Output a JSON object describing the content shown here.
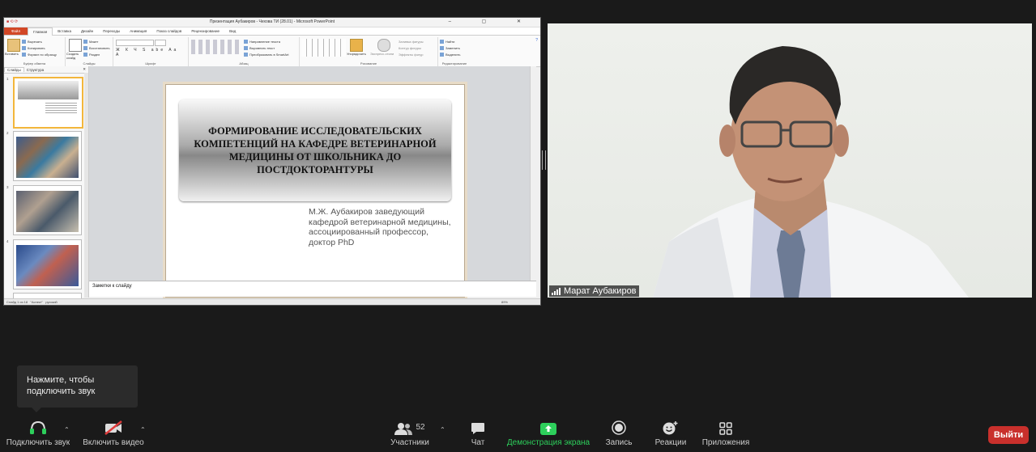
{
  "ppt": {
    "window_title": "Презентация Аубакиров - Чехова ТИ (28.01) - Microsoft PowerPoint",
    "tabs": [
      "Файл",
      "Главная",
      "Вставка",
      "Дизайн",
      "Переходы",
      "Анимация",
      "Показ слайдов",
      "Рецензирование",
      "Вид"
    ],
    "ribbon": {
      "clipboard": {
        "label": "Буфер обмена",
        "paste": "Вставить",
        "cut": "Вырезать",
        "copy": "Копировать",
        "format": "Формат по образцу"
      },
      "slides": {
        "label": "Слайды",
        "new_slide": "Создать слайд",
        "layout": "Макет",
        "reset": "Восстановить",
        "section": "Раздел"
      },
      "font": {
        "label": "Шрифт"
      },
      "paragraph": {
        "label": "Абзац",
        "direction": "Направление текста",
        "align": "Выровнять текст",
        "smartart": "Преобразовать в SmartArt"
      },
      "drawing": {
        "label": "Рисование",
        "arrange": "Упорядочить",
        "quick_styles": "Экспресс-стили",
        "fill": "Заливка фигуры",
        "outline": "Контур фигуры",
        "effects": "Эффекты фигур"
      },
      "editing": {
        "label": "Редактирование",
        "find": "Найти",
        "replace": "Заменить",
        "select": "Выделить"
      }
    },
    "panel_tabs": [
      "Слайды",
      "Структура"
    ],
    "thumb_numbers": [
      "1",
      "2",
      "3",
      "4"
    ],
    "slide": {
      "title": "ФОРМИРОВАНИЕ ИССЛЕДОВАТЕЛЬСКИХ КОМПЕТЕНЦИЙ НА КАФЕДРЕ ВЕТЕРИНАРНОЙ МЕДИЦИНЫ ОТ ШКОЛЬНИКА  ДО ПОСТДОКТОРАНТУРЫ",
      "subtitle": "М.Ж. Аубакиров заведующий кафедрой ветеринарной медицины, ассоциированный профессор, доктор PhD"
    },
    "notes_placeholder": "Заметки к слайду",
    "status": {
      "slide_info": "Слайд 1 из 18",
      "theme": "\"Аспект\"",
      "language": "русский",
      "zoom": "89%"
    }
  },
  "video": {
    "participant_name": "Марат Аубакиров"
  },
  "tooltip": {
    "text": "Нажмите, чтобы подключить звук"
  },
  "toolbar": {
    "join_audio": "Подключить звук",
    "start_video": "Включить видео",
    "participants": "Участники",
    "participants_count": "52",
    "chat": "Чат",
    "share_screen": "Демонстрация экрана",
    "record": "Запись",
    "reactions": "Реакции",
    "apps": "Приложения",
    "leave": "Выйти"
  },
  "colors": {
    "share_green": "#2dcf5b",
    "leave_red": "#c9302c",
    "ppt_file_tab": "#d24726"
  }
}
